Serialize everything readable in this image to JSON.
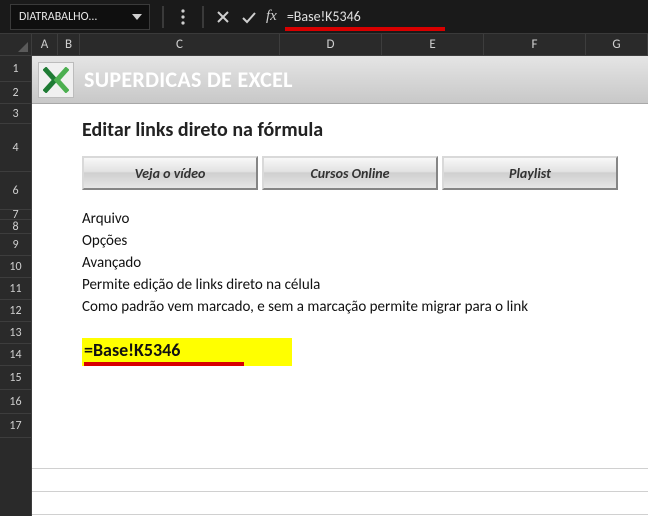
{
  "namebox": {
    "value": "DIATRABALHO..."
  },
  "formula": {
    "value": "=Base!K5346",
    "fx_label": "fx"
  },
  "columns": [
    "A",
    "B",
    "C",
    "D",
    "E",
    "F",
    "G"
  ],
  "rows": [
    "1",
    "2",
    "3",
    "4",
    "6",
    "7",
    "8",
    "9",
    "10",
    "11",
    "12",
    "13",
    "14",
    "15",
    "16",
    "17"
  ],
  "row_heights": {
    "1": 26,
    "2": 22,
    "3": 20,
    "4": 48,
    "6": 38,
    "7": 10,
    "8": 14,
    "9": 22,
    "10": 22,
    "11": 22,
    "12": 22,
    "13": 22,
    "14": 22,
    "15": 24,
    "16": 24,
    "17": 24
  },
  "banner": {
    "title": "SUPERDICAS DE EXCEL"
  },
  "section": {
    "title": "Editar links direto na fórmula"
  },
  "buttons": {
    "video": "Veja o vídeo",
    "cursos": "Cursos Online",
    "playlist": "Playlist"
  },
  "lines": {
    "l1": "Arquivo",
    "l2": "Opções",
    "l3": "Avançado",
    "l4": "Permite edição de links direto na célula",
    "l5": "Como padrão vem marcado, e sem a marcação permite migrar para o link"
  },
  "highlight": {
    "text": "=Base!K5346"
  }
}
